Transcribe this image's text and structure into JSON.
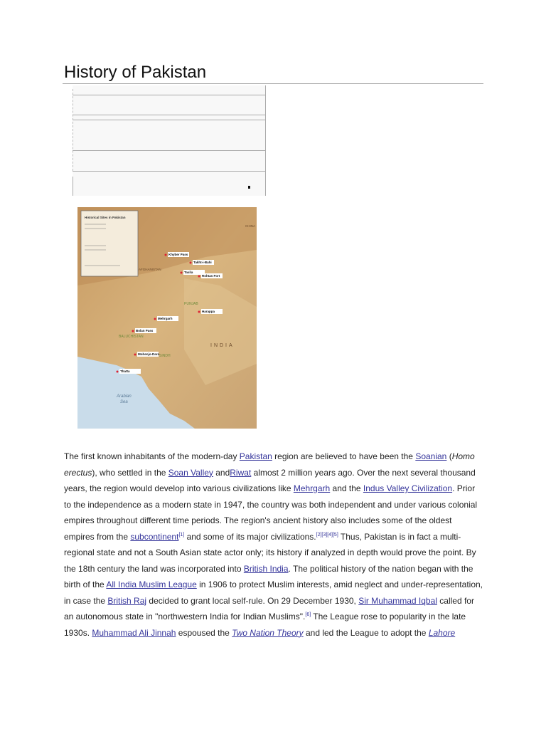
{
  "page": {
    "title": "History of Pakistan"
  },
  "map": {
    "legend_title": "Historical Sites in Pakistan",
    "labels": {
      "china": "CHINA",
      "afghanistan": "AFGHANISTAN",
      "punjab": "PUNJAB",
      "baluchistan": "BALUCHISTAN",
      "sindh": "SINDH",
      "india": "INDIA",
      "arabian_sea_1": "Arabian",
      "arabian_sea_2": "Sea"
    },
    "sites": [
      "Khyber Pass",
      "Takht-i-Bahi",
      "Taxila",
      "Rohtas Fort",
      "Mehrgarh",
      "Harappa",
      "Bolan Pass",
      "Mohenjo-Daro",
      "Thatta"
    ]
  },
  "article": {
    "lines": [
      [
        {
          "t": "The first known inhabitants of the modern-day "
        },
        {
          "t": "Pakistan",
          "link": true
        },
        {
          "t": " region are believed to have been the "
        },
        {
          "t": "Soanian",
          "link": true
        },
        {
          "t": " ("
        },
        {
          "t": "Homo",
          "i": true
        }
      ],
      [
        {
          "t": "erectus",
          "i": true
        },
        {
          "t": "), who settled in the "
        },
        {
          "t": "Soan Valley",
          "link": true
        },
        {
          "t": " and"
        },
        {
          "t": "Riwat",
          "link": true
        },
        {
          "t": " almost 2 million years ago. Over the next several thousand"
        }
      ],
      [
        {
          "t": "years, the region would develop into various civilizations like "
        },
        {
          "t": "Mehrgarh",
          "link": true
        },
        {
          "t": " and the "
        },
        {
          "t": "Indus Valley Civilization",
          "link": true
        },
        {
          "t": ". Prior"
        }
      ],
      [
        {
          "t": "to the independence as a modern state in 1947, the country was both independent and under various colonial"
        }
      ],
      [
        {
          "t": "empires throughout different time periods. The region's ancient history also includes some of the oldest"
        }
      ],
      [
        {
          "t": "empires from the "
        },
        {
          "t": "subcontinent",
          "link": true
        },
        {
          "t": "[1]",
          "sup": true
        },
        {
          "t": " and some of its major civilizations."
        },
        {
          "t": "[2][3][4][5]",
          "sup": true
        },
        {
          "t": " Thus, Pakistan is in fact a multi-"
        }
      ],
      [
        {
          "t": "regional state and not a South Asian state actor only; its history if analyzed in depth would prove the point. By"
        }
      ],
      [
        {
          "t": "the 18th century the land was incorporated into "
        },
        {
          "t": "British India",
          "link": true
        },
        {
          "t": ". The political history of the nation began with the"
        }
      ],
      [
        {
          "t": "birth of the "
        },
        {
          "t": "All India Muslim League",
          "link": true
        },
        {
          "t": " in 1906 to protect Muslim interests, amid neglect and under-representation,"
        }
      ],
      [
        {
          "t": "in case the "
        },
        {
          "t": "British Raj",
          "link": true
        },
        {
          "t": " decided to grant local self-rule. On 29 December 1930, "
        },
        {
          "t": "Sir Muhammad Iqbal",
          "link": true
        },
        {
          "t": " called for"
        }
      ],
      [
        {
          "t": "an autonomous state in \"northwestern India for Indian Muslims\"."
        },
        {
          "t": "[6]",
          "sup": true
        },
        {
          "t": " The League rose to popularity in the late"
        }
      ],
      [
        {
          "t": "1930s. "
        },
        {
          "t": "Muhammad Ali Jinnah",
          "link": true
        },
        {
          "t": " espoused the "
        },
        {
          "t": "Two Nation Theory",
          "link": true,
          "i": true
        },
        {
          "t": " and led the League to adopt the "
        },
        {
          "t": "Lahore",
          "link": true,
          "i": true
        }
      ]
    ]
  }
}
